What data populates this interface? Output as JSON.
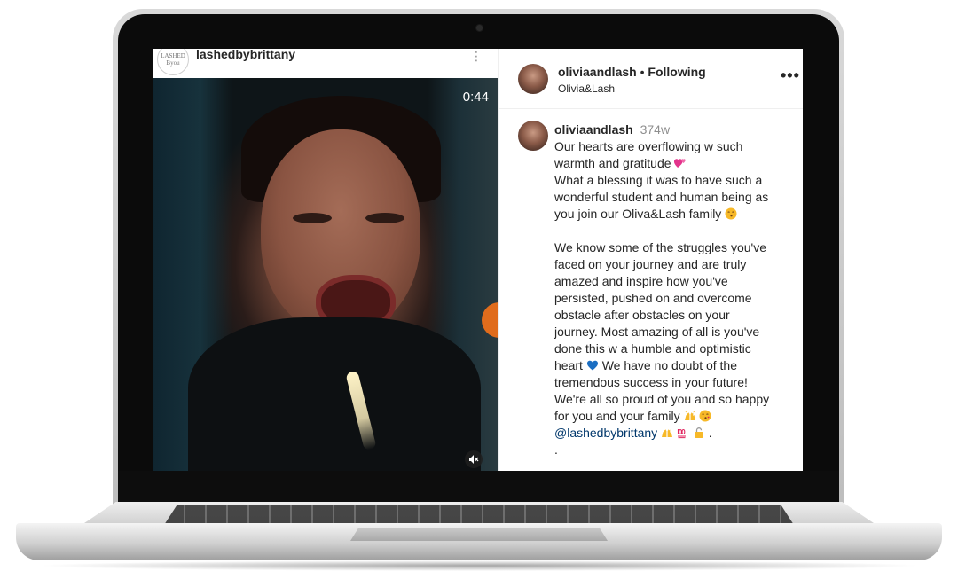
{
  "video_post": {
    "author": "lashedbybrittany",
    "avatar_text": "LASHED Byou",
    "more_glyph": "⋮",
    "duration": "0:44"
  },
  "side_panel": {
    "header": {
      "username": "oliviaandlash",
      "separator": " • ",
      "follow_state": "Following",
      "subtitle": "Olivia&Lash",
      "more_glyph": "•••"
    },
    "caption": {
      "username": "oliviaandlash",
      "age": "374w",
      "lines": [
        "Our hearts are overflowing w such",
        "warmth and gratitude",
        "What a blessing it was to have such a",
        "wonderful student and human being as",
        "you join our Oliva&Lash family",
        "",
        "We know some of the struggles you've",
        "faced on your journey and are truly",
        "amazed and inspire how you've",
        "persisted, pushed on and overcome",
        "obstacle after obstacles on your",
        "journey. Most amazing of all is you've",
        "done this w a humble and optimistic",
        "heart",
        "We have no doubt of the",
        "tremendous success in your future!",
        "We're all so proud of you and so happy",
        "for you and your family",
        "@lashedbybrittany",
        "."
      ]
    }
  },
  "icons": {
    "heart_pink": "two-hearts-icon",
    "kiss": "kissing-face-icon",
    "heart_blue": "blue-heart-icon",
    "raised_hands": "raised-hands-icon",
    "hundred": "hundred-points-icon",
    "lock": "lock-icon",
    "mute": "muted-speaker-icon"
  },
  "colors": {
    "text": "#262626",
    "muted": "#8e8e8e",
    "mention": "#00376b"
  }
}
